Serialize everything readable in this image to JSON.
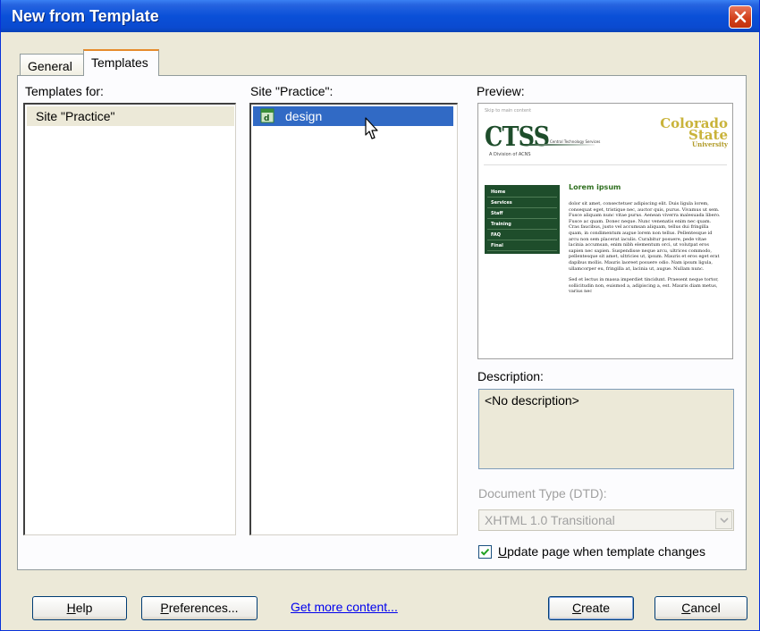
{
  "window": {
    "title": "New from Template",
    "close_icon": "close-icon"
  },
  "tabs": [
    {
      "label": "General",
      "active": false
    },
    {
      "label": "Templates",
      "active": true
    }
  ],
  "templates_for": {
    "label": "Templates for:",
    "items": [
      {
        "label": "Site \"Practice\"",
        "selected": true
      }
    ]
  },
  "site_list": {
    "label": "Site \"Practice\":",
    "items": [
      {
        "label": "design",
        "selected": true,
        "icon": "template-file-icon"
      }
    ]
  },
  "preview": {
    "label": "Preview:",
    "skip_link": "Skip to main content",
    "logo": "CTSS",
    "logo_small": "Central Technology Services",
    "logo_sub": "A Division of ACNS",
    "csu": {
      "line1": "Colorado",
      "line2": "State",
      "line3": "University"
    },
    "nav": [
      "Home",
      "Services",
      "Staff",
      "Training",
      "FAQ",
      "Final"
    ],
    "heading": "Lorem ipsum",
    "para1": "dolor sit amet, consectetuer adipiscing elit. Duis ligula lorem, consequat eget, tristique nec, auctor quis, purus. Vivamus ut sem. Fusce aliquam nunc vitae purus. Aenean viverra malesuada libero. Fusce ac quam. Donec neque. Nunc venenatis enim nec quam. Cras faucibus, justo vel accumsan aliquam, tellus dui fringilla quam, in condimentum augue lorem non tellus. Pellentesque id arcu non sem placerat iaculis. Curabitur posuere, pede vitae lacinia accumsan, enim nibh elementum orci, ut volutpat eros sapien nec sapien. Suspendisse neque arcu, ultrices commodo, pellentesque sit amet, ultricies ut, ipsum. Mauris et eros eget erat dapibus mollis. Mauris laoreet posuere odio. Nam ipsum ligula, ullamcorper eu, fringilla at, lacinia ut, augue. Nullam nunc.",
    "para2": "Sed et lectus in massa imperdiet tincidunt. Praesent neque tortor, sollicitudin non, euismod a, adipiscing a, est. Mauris diam metus, varius nec"
  },
  "description": {
    "label": "Description:",
    "value": "<No description>"
  },
  "doctype": {
    "label": "Document Type (DTD):",
    "value": "XHTML 1.0 Transitional",
    "enabled": false
  },
  "update_checkbox": {
    "label_underlined": "U",
    "label_rest": "pdate page when template changes",
    "checked": true
  },
  "buttons": {
    "help_u": "H",
    "help_rest": "elp",
    "pref_u": "P",
    "pref_rest": "references...",
    "more_link": "Get more content...",
    "create_u": "C",
    "create_rest": "reate",
    "cancel_u": "C",
    "cancel_rest": "ancel"
  },
  "colors": {
    "selection": "#316ac5",
    "title_bar": "#0a50d8",
    "panel_bg": "#ece9d8",
    "link": "#0000ee"
  }
}
